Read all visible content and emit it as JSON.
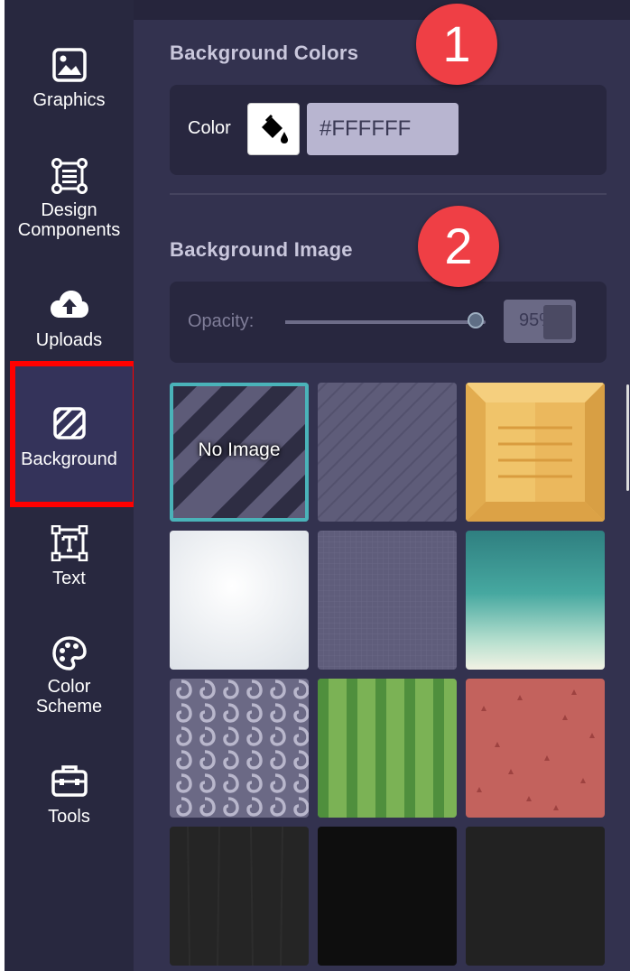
{
  "sidebar": {
    "items": [
      {
        "label": "Graphics",
        "icon": "image-icon"
      },
      {
        "label": "Design Components",
        "label_line1": "Design",
        "label_line2": "Components",
        "icon": "components-icon"
      },
      {
        "label": "Uploads",
        "icon": "cloud-upload-icon"
      },
      {
        "label": "Background",
        "icon": "background-hatch-icon",
        "active": true
      },
      {
        "label": "Text",
        "icon": "text-box-icon"
      },
      {
        "label": "Color Scheme",
        "label_line1": "Color",
        "label_line2": "Scheme",
        "icon": "palette-icon"
      },
      {
        "label": "Tools",
        "icon": "toolbox-icon"
      }
    ],
    "highlight_color": "#ff0000"
  },
  "background_colors": {
    "title": "Background Colors",
    "color_label": "Color",
    "swatch_color": "#FFFFFF",
    "swatch_icon": "paint-bucket-icon",
    "hex_value": "#FFFFFF"
  },
  "background_image": {
    "title": "Background Image",
    "opacity_label": "Opacity:",
    "opacity_value": "95%",
    "opacity_fraction": 0.95,
    "tiles": [
      {
        "kind": "none",
        "label": "No Image",
        "selected": true
      },
      {
        "kind": "diagonal-stripes"
      },
      {
        "kind": "wooden-crate"
      },
      {
        "kind": "white-vignette"
      },
      {
        "kind": "grid-fabric"
      },
      {
        "kind": "teal-gradient"
      },
      {
        "kind": "swirl-pattern"
      },
      {
        "kind": "green-stripes"
      },
      {
        "kind": "red-triangles"
      },
      {
        "kind": "dark-wood"
      },
      {
        "kind": "black"
      },
      {
        "kind": "dark-gray"
      }
    ]
  },
  "annotations": {
    "badge1": "1",
    "badge2": "2",
    "badge_color": "#ef3f45"
  },
  "colors": {
    "sidebar_bg": "#28283f",
    "panel_bg": "#33324f",
    "card_bg": "#28273f",
    "selected_tile_border": "#4ab3b9"
  }
}
